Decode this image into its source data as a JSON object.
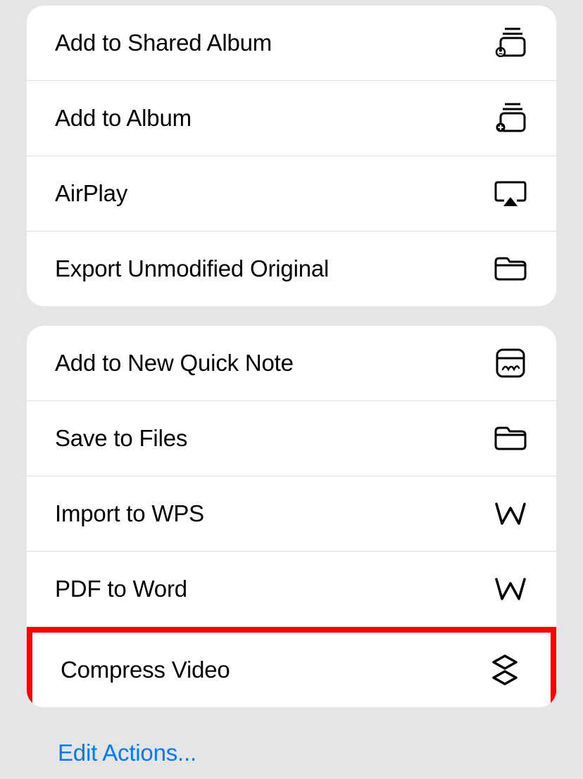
{
  "groups": [
    {
      "items": [
        {
          "label": "Add to Shared Album",
          "icon": "album-shared-icon"
        },
        {
          "label": "Add to Album",
          "icon": "album-add-icon"
        },
        {
          "label": "AirPlay",
          "icon": "airplay-icon"
        },
        {
          "label": "Export Unmodified Original",
          "icon": "folder-icon"
        }
      ]
    },
    {
      "items": [
        {
          "label": "Add to New Quick Note",
          "icon": "quick-note-icon"
        },
        {
          "label": "Save to Files",
          "icon": "folder-icon"
        },
        {
          "label": "Import to WPS",
          "icon": "wps-icon"
        },
        {
          "label": "PDF to Word",
          "icon": "wps-icon"
        },
        {
          "label": "Compress Video",
          "icon": "compress-icon",
          "highlighted": true
        }
      ]
    }
  ],
  "footer": {
    "edit_actions_label": "Edit Actions..."
  }
}
